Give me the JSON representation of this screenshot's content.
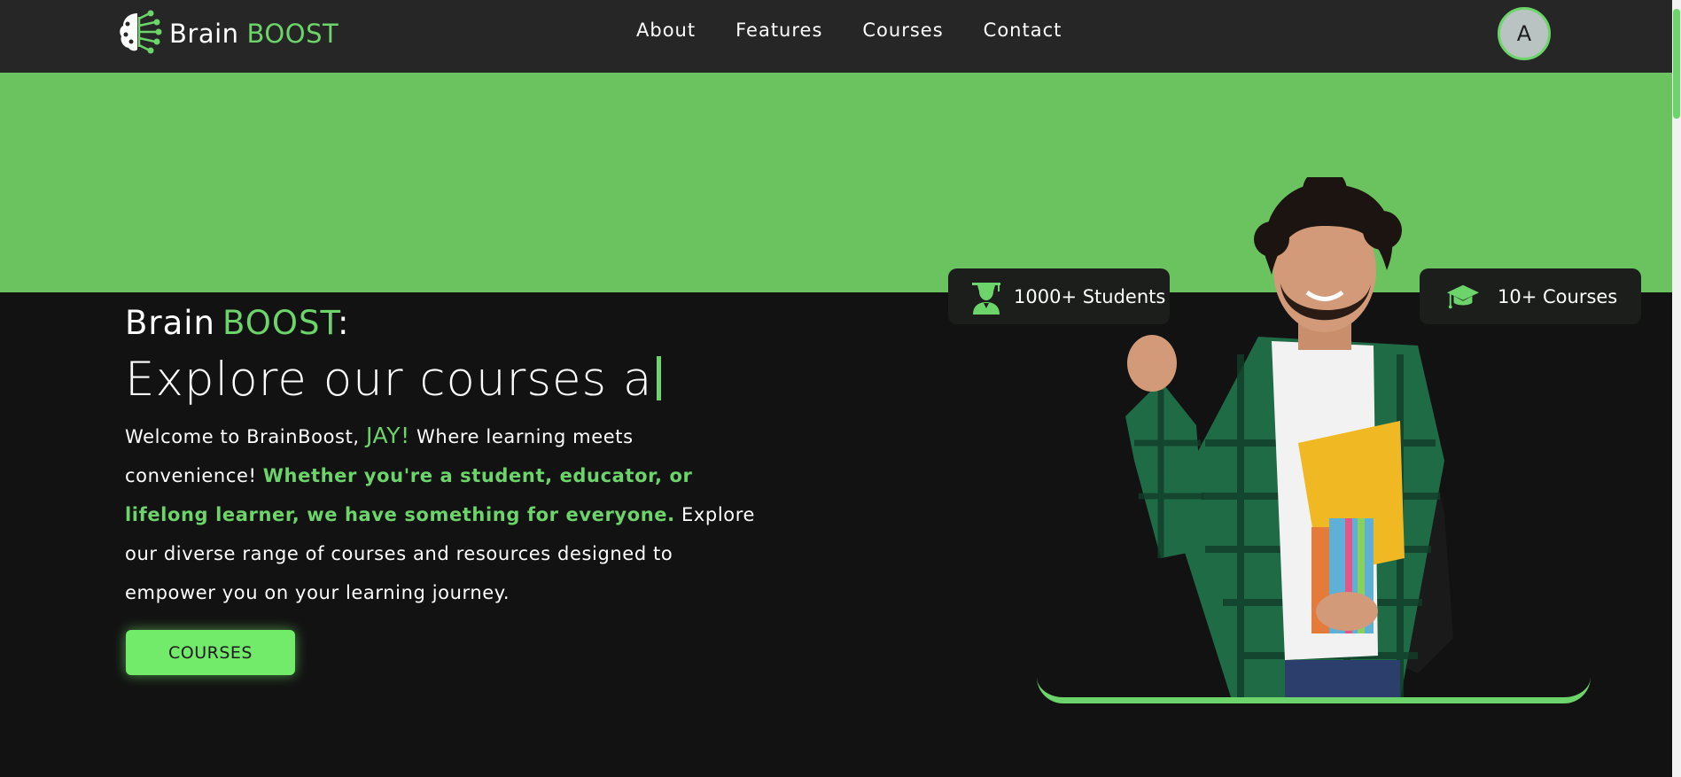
{
  "navbar": {
    "logo": {
      "brain": "Brain",
      "boost": "BOOST",
      "icon": "brain-circuit-icon"
    },
    "links": [
      "About",
      "Features",
      "Courses",
      "Contact"
    ],
    "avatar_initial": "A"
  },
  "hero": {
    "brand": {
      "brain": "Brain",
      "boost": "BOOST",
      "colon": ":"
    },
    "title": "Explore our courses a",
    "description": {
      "part1": "Welcome to BrainBoost, ",
      "name": "JAY!",
      "part2": " Where learning meets convenience! ",
      "highlight": "Whether you're a student, educator, or lifelong learner, we have something for everyone.",
      "part3": " Explore our diverse range of courses and resources designed to empower you on your learning journey."
    },
    "cta_label": "COURSES"
  },
  "stats": {
    "students": {
      "label": "1000+ Students",
      "icon": "student-graduate-icon"
    },
    "courses": {
      "label": "10+ Courses",
      "icon": "graduation-cap-icon"
    }
  },
  "colors": {
    "accent": "#6cd46a",
    "band": "#6bc360",
    "background": "#121212",
    "navbar": "#262626"
  }
}
